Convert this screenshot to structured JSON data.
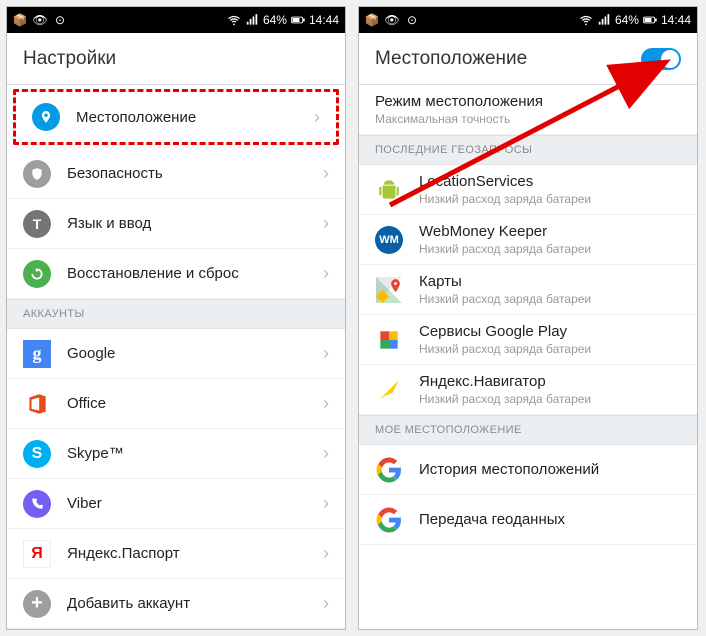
{
  "statusbar": {
    "battery_text": "64%",
    "time": "14:44"
  },
  "left_screen": {
    "title": "Настройки",
    "items": [
      {
        "label": "Местоположение"
      },
      {
        "label": "Безопасность"
      },
      {
        "label": "Язык и ввод"
      },
      {
        "label": "Восстановление и сброс"
      }
    ],
    "section1": "АККАУНТЫ",
    "accounts": [
      {
        "label": "Google"
      },
      {
        "label": "Office"
      },
      {
        "label": "Skype™"
      },
      {
        "label": "Viber"
      },
      {
        "label": "Яндекс.Паспорт"
      },
      {
        "label": "Добавить аккаунт"
      }
    ]
  },
  "right_screen": {
    "title": "Местоположение",
    "mode": {
      "title": "Режим местоположения",
      "sub": "Максимальная точность"
    },
    "section_recent": "ПОСЛЕДНИЕ ГЕОЗАПРОСЫ",
    "recent": [
      {
        "label": "LocationServices",
        "sub": "Низкий расход заряда батареи"
      },
      {
        "label": "WebMoney Keeper",
        "sub": "Низкий расход заряда батареи"
      },
      {
        "label": "Карты",
        "sub": "Низкий расход заряда батареи"
      },
      {
        "label": "Сервисы Google Play",
        "sub": "Низкий расход заряда батареи"
      },
      {
        "label": "Яндекс.Навигатор",
        "sub": "Низкий расход заряда батареи"
      }
    ],
    "section_my": "МОЕ МЕСТОПОЛОЖЕНИЕ",
    "my": [
      {
        "label": "История местоположений"
      },
      {
        "label": "Передача геоданных"
      }
    ]
  }
}
